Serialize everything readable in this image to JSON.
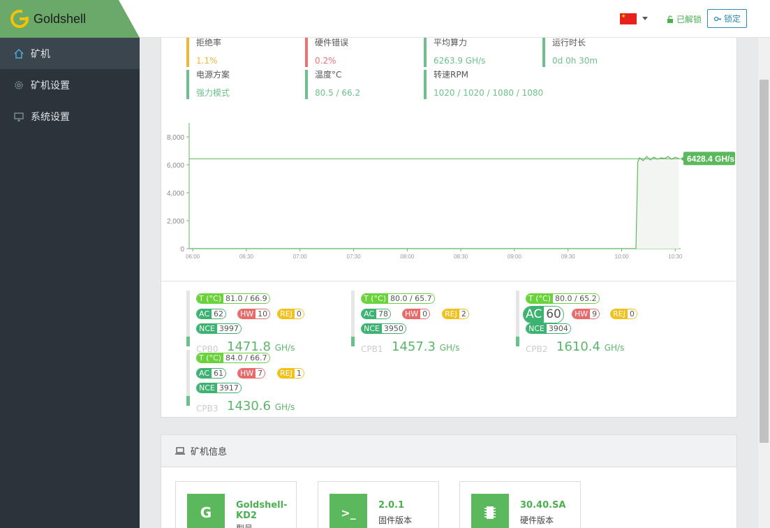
{
  "brand": {
    "name": "Goldshell"
  },
  "sidebar": {
    "items": [
      {
        "label": "矿机",
        "icon": "home-icon",
        "active": true
      },
      {
        "label": "矿机设置",
        "icon": "gear-icon",
        "active": false
      },
      {
        "label": "系统设置",
        "icon": "monitor-icon",
        "active": false
      }
    ]
  },
  "header": {
    "language_flag": "china-flag",
    "unlocked_label": "已解锁",
    "lock_button": "锁定"
  },
  "stats": [
    {
      "label": "拒绝率",
      "value": "1.1%",
      "color": "#f2b632"
    },
    {
      "label": "硬件错误",
      "value": "0.2%",
      "color": "#ee7272"
    },
    {
      "label": "平均算力",
      "value": "6263.9 GH/s",
      "color": "#6cc08b"
    },
    {
      "label": "运行时长",
      "value": "0d 0h 30m",
      "color": "#6cc08b"
    },
    {
      "label": "电源方案",
      "value": "强力模式",
      "color": "#6cc08b"
    },
    {
      "label": "温度°C",
      "value": "80.5 / 66.2",
      "color": "#6cc08b"
    },
    {
      "label": "转速RPM",
      "value": "1020 / 1020 / 1080 / 1080",
      "color": "#6cc08b"
    }
  ],
  "chart_data": {
    "type": "line",
    "title": "",
    "xlabel": "",
    "ylabel": "",
    "x_ticks": [
      "06:00",
      "06:30",
      "07:00",
      "07:30",
      "08:00",
      "08:30",
      "09:00",
      "09:30",
      "10:00",
      "10:30"
    ],
    "y_ticks": [
      "0",
      "2,000",
      "4,000",
      "6,000",
      "8,000"
    ],
    "ylim": [
      0,
      9000
    ],
    "xlim": [
      "05:58",
      "10:33"
    ],
    "series": [
      {
        "x": [
          "05:58",
          "10:07",
          "10:08",
          "10:09",
          "10:10",
          "10:12",
          "10:14",
          "10:16",
          "10:18",
          "10:20",
          "10:22",
          "10:24",
          "10:26",
          "10:28",
          "10:30",
          "10:31",
          "10:32"
        ],
        "values": [
          0,
          0,
          0,
          6200,
          6500,
          6300,
          6600,
          6350,
          6550,
          6400,
          6500,
          6450,
          6600,
          6400,
          6550,
          6500,
          6450
        ]
      }
    ],
    "reference_line": 6428.4,
    "current_label": "6428.4 GH/s",
    "grid": false,
    "line_color": "#5cb85c"
  },
  "boards": [
    {
      "name": "CPB0",
      "rate": "1471.8",
      "unit": "GH/s",
      "temp": "81.0 / 66.9",
      "ac": "62",
      "hw": "10",
      "rej": "0",
      "nce": "3997",
      "big_ac": false
    },
    {
      "name": "CPB1",
      "rate": "1457.3",
      "unit": "GH/s",
      "temp": "80.0 / 65.7",
      "ac": "78",
      "hw": "0",
      "rej": "2",
      "nce": "3950",
      "big_ac": false
    },
    {
      "name": "CPB2",
      "rate": "1610.4",
      "unit": "GH/s",
      "temp": "80.0 / 65.2",
      "ac": "60",
      "hw": "9",
      "rej": "0",
      "nce": "3904",
      "big_ac": true
    },
    {
      "name": "CPB3",
      "rate": "1430.6",
      "unit": "GH/s",
      "temp": "84.0 / 66.7",
      "ac": "61",
      "hw": "7",
      "rej": "1",
      "nce": "3917",
      "big_ac": false
    }
  ],
  "chip_labels": {
    "temp": "T (°C)",
    "ac": "AC",
    "hw": "HW",
    "rej": "REJ",
    "nce": "NCE"
  },
  "info": {
    "title": "矿机信息",
    "cards": [
      {
        "icon": "goldshell-logo-icon",
        "value": "Goldshell-KD2",
        "label": "型号"
      },
      {
        "icon": "terminal-icon",
        "value": "2.0.1",
        "label": "固件版本"
      },
      {
        "icon": "chip-icon",
        "value": "30.40.SA",
        "label": "硬件版本"
      }
    ]
  }
}
